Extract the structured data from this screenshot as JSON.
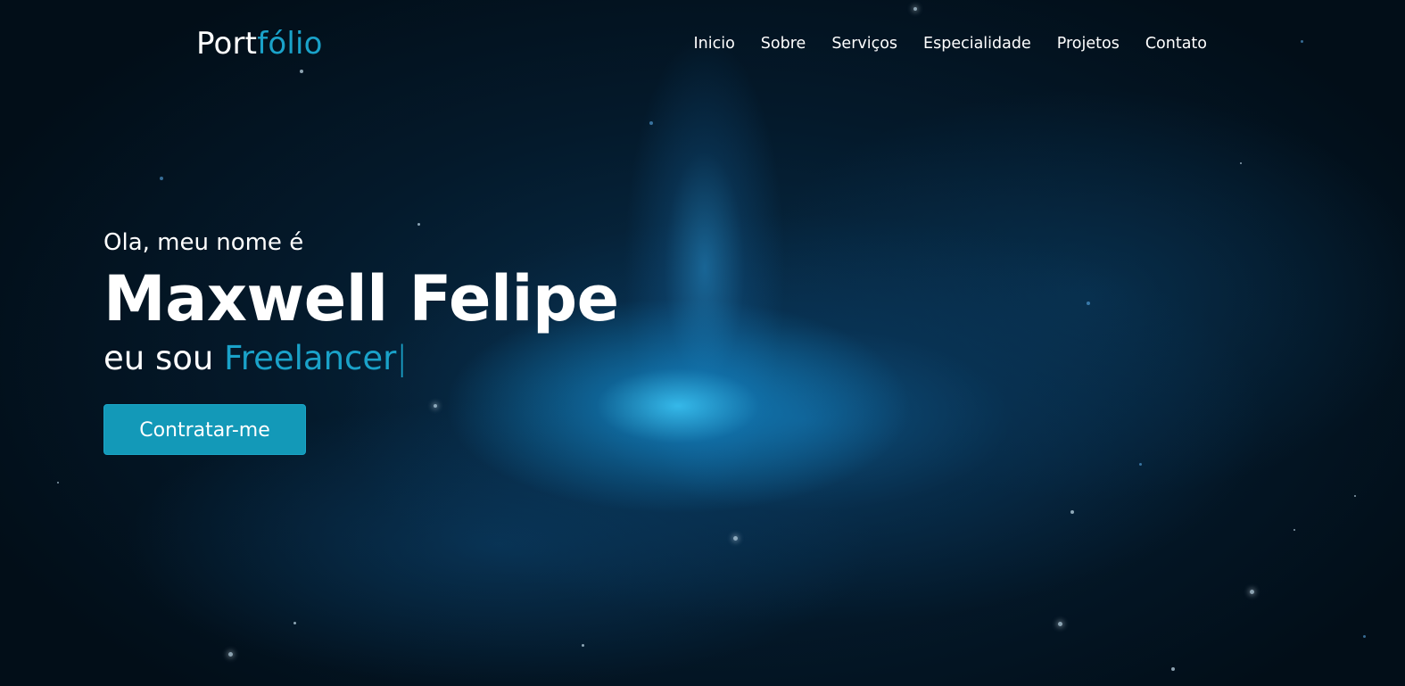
{
  "header": {
    "logo_main": "Port",
    "logo_accent": "fólio",
    "nav": [
      {
        "label": "Inicio"
      },
      {
        "label": "Sobre"
      },
      {
        "label": "Serviços"
      },
      {
        "label": "Especialidade"
      },
      {
        "label": "Projetos"
      },
      {
        "label": "Contato"
      }
    ]
  },
  "hero": {
    "greeting": "Ola, meu nome é",
    "name": "Maxwell Felipe",
    "role_prefix": "eu sou ",
    "role_typed": "Freelancer",
    "cursor": "|",
    "button_label": "Contratar-me"
  },
  "colors": {
    "accent": "#1aa2c9",
    "button_bg": "#1399b8",
    "background": "#03111d",
    "text": "#ffffff"
  }
}
